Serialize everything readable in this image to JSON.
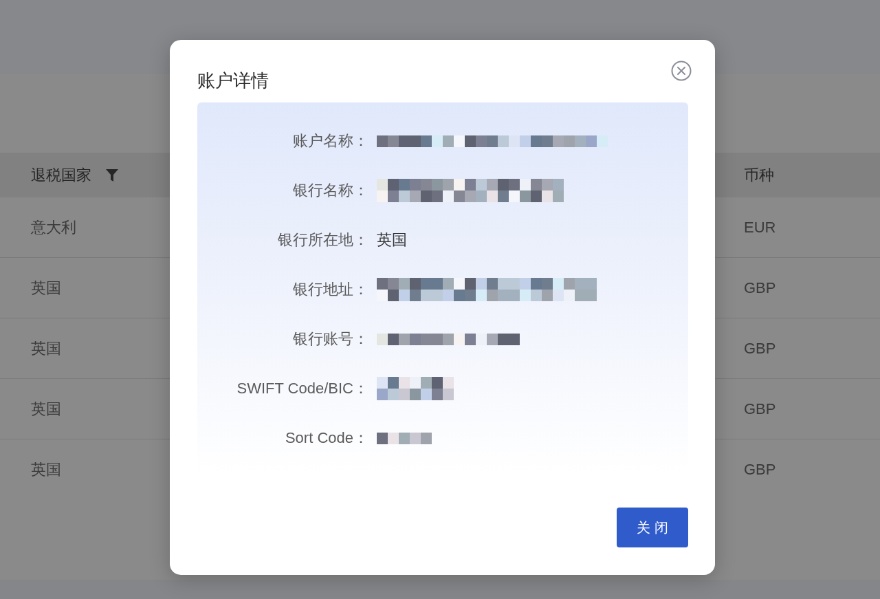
{
  "page": {
    "table": {
      "columns": [
        {
          "label": "退税国家",
          "filter": true
        },
        {
          "label": "币种"
        }
      ],
      "rows": [
        [
          "意大利",
          "EUR"
        ],
        [
          "英国",
          "GBP"
        ],
        [
          "英国",
          "GBP"
        ],
        [
          "英国",
          "GBP"
        ],
        [
          "英国",
          "GBP"
        ]
      ]
    }
  },
  "dialog": {
    "title": "账户详情",
    "fields": [
      {
        "label": "账户名称：",
        "kind": "redacted"
      },
      {
        "label": "银行名称：",
        "kind": "redacted"
      },
      {
        "label": "银行所在地：",
        "kind": "text",
        "value": "英国"
      },
      {
        "label": "银行地址：",
        "kind": "redacted"
      },
      {
        "label": "银行账号：",
        "kind": "redacted"
      },
      {
        "label": "SWIFT Code/BIC：",
        "kind": "redacted"
      },
      {
        "label": "Sort Code：",
        "kind": "redacted"
      }
    ],
    "buttons": [
      {
        "label": "关闭",
        "kind": "primary"
      }
    ]
  }
}
